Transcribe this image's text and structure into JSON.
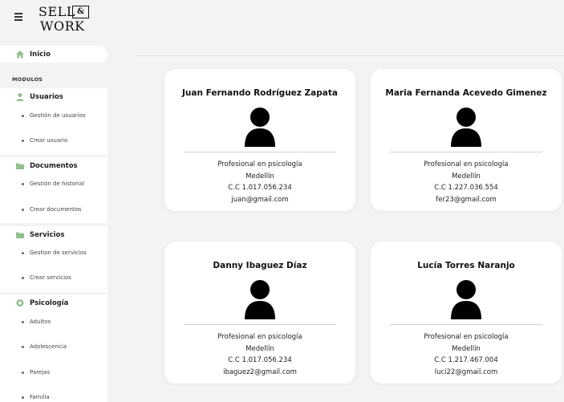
{
  "brand": {
    "line1": "SELL",
    "amp": "&",
    "line2": "WORK"
  },
  "sidebar": {
    "home": "Inicio",
    "section_label": "MODULOS",
    "groups": [
      {
        "label": "Usuarios",
        "icon": "user-icon",
        "items": [
          "Gestión de usuarios",
          "Crear usuario"
        ]
      },
      {
        "label": "Documentos",
        "icon": "folder-icon",
        "items": [
          "Gestión de historial",
          "Crear documentos"
        ]
      },
      {
        "label": "Servicios",
        "icon": "folder-icon",
        "items": [
          "Gestion de servicios",
          "Crear servicios"
        ]
      },
      {
        "label": "Psicología",
        "icon": "brain-icon",
        "items": [
          "Adultos",
          "Adolescencia",
          "Parejas",
          "Familia"
        ]
      }
    ]
  },
  "colors": {
    "accent": "#7fb77e",
    "background": "#f2f3f5",
    "card": "#ffffff"
  },
  "cards": [
    {
      "name": "Juan Fernando Rodríguez Zapata",
      "profession": "Profesional en psicología",
      "city": "Medellín",
      "id": "C.C 1.017.056.234",
      "email": "juan@gmail.com"
    },
    {
      "name": "Maria Fernanda Acevedo Gimenez",
      "profession": "Profesional en psicología",
      "city": "Medellín",
      "id": "C.C 1.227.036.554",
      "email": "fer23@gmail.com"
    },
    {
      "name": "Danny Ibaguez Díaz",
      "profession": "Profesional en psicología",
      "city": "Medellín",
      "id": "C.C 1.017.056.234",
      "email": "ibaguez2@gmail.com"
    },
    {
      "name": "Lucía Torres Naranjo",
      "profession": "Profesional en psicología",
      "city": "Medellín",
      "id": "C.C 1.217.467.004",
      "email": "luci22@gmail.com"
    }
  ]
}
